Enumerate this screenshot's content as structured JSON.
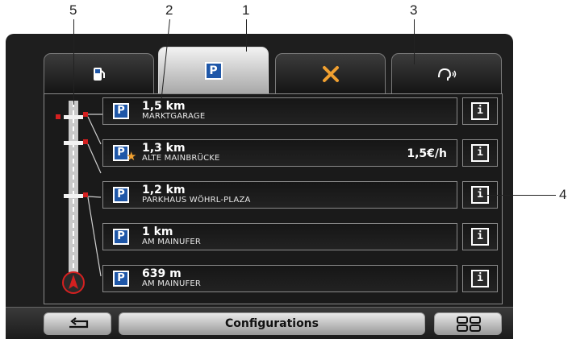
{
  "callouts": [
    "5",
    "2",
    "1",
    "3",
    "4"
  ],
  "tabs": [
    {
      "icon": "fuel-station-icon"
    },
    {
      "icon": "parking-icon",
      "glyph": "P",
      "active": true
    },
    {
      "icon": "poi-cross-icon"
    },
    {
      "icon": "voice-speak-icon"
    }
  ],
  "parking_list": [
    {
      "distance": "1,5 km",
      "name": "MARKTGARAGE",
      "icon": "parking-covered-icon",
      "glyph": "P̂"
    },
    {
      "distance": "1,3 km",
      "name": "ALTE MAINBRÜCKE",
      "price": "1,5€/h",
      "icon": "parking-covered-favorite-icon",
      "glyph": "P̂"
    },
    {
      "distance": "1,2 km",
      "name": "PARKHAUS WÖHRL-PLAZA",
      "icon": "parking-covered-icon",
      "glyph": "P̂"
    },
    {
      "distance": "1 km",
      "name": "AM MAINUFER",
      "icon": "parking-icon",
      "glyph": "P"
    },
    {
      "distance": "639 m",
      "name": "AM MAINUFER",
      "icon": "parking-icon",
      "glyph": "P"
    }
  ],
  "info_button_glyph": "i",
  "bottom_bar": {
    "back_icon": "back-arrow-icon",
    "title": "Configurations",
    "menu_icon": "menu-grid-icon"
  },
  "colors": {
    "parking_blue": "#1f57a8",
    "route_marker_red": "#d42020",
    "favorite_star": "#f0a030"
  }
}
